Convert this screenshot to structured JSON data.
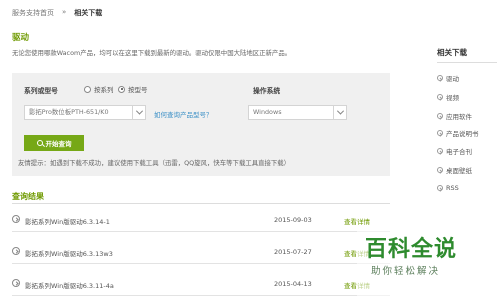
{
  "breadcrumb": {
    "home": "服务支持首页",
    "separator": "»",
    "current": "相关下载"
  },
  "driver": {
    "title": "驱动",
    "intro": "无论您使用哪款Wacom产品，均可以在这里下载到最新的驱动。驱动仅限中国大陆地区正新产品。"
  },
  "search_panel": {
    "series_label": "系列或型号",
    "radio_series": "按系列",
    "radio_model": "按型号",
    "model_value": "影拓Pro数位板PTH-651/K0",
    "how_link": "如何查询产品型号？",
    "os_label": "操作系统",
    "os_value": "Windows",
    "search_button": "开始查询",
    "tip": "友情提示：如遇到下载不成功，建议使用下载工具（迅雷，QQ旋风，快车等下载工具直接下载）"
  },
  "results": {
    "title": "查询结果",
    "rows": [
      {
        "name": "影拓系列Win版驱动6.3.14-1",
        "date": "2015-09-03",
        "action": "查看详情"
      },
      {
        "name": "影拓系列Win版驱动6.3.13w3",
        "date": "2015-07-27",
        "action": "查看详情"
      },
      {
        "name": "影拓系列Win版驱动6.3.11-4a",
        "date": "2015-04-13",
        "action": "查看详情"
      }
    ]
  },
  "sidebar": {
    "title": "相关下载",
    "items": [
      {
        "label": "驱动"
      },
      {
        "label": "视频"
      },
      {
        "label": "应用软件"
      },
      {
        "label": "产品说明书"
      },
      {
        "label": "电子合刊"
      },
      {
        "label": "桌面壁纸"
      },
      {
        "label": "RSS"
      }
    ]
  },
  "watermark": {
    "main": "百科全说",
    "sub": "助你轻松解决"
  },
  "colors": {
    "accent": "#76a816",
    "link": "#3a8fc6",
    "panel_bg": "#f0f0f0"
  },
  "icons": {
    "search": "search-icon",
    "dropdown": "chevron-down-icon",
    "row": "chevron-right-circle-icon"
  }
}
